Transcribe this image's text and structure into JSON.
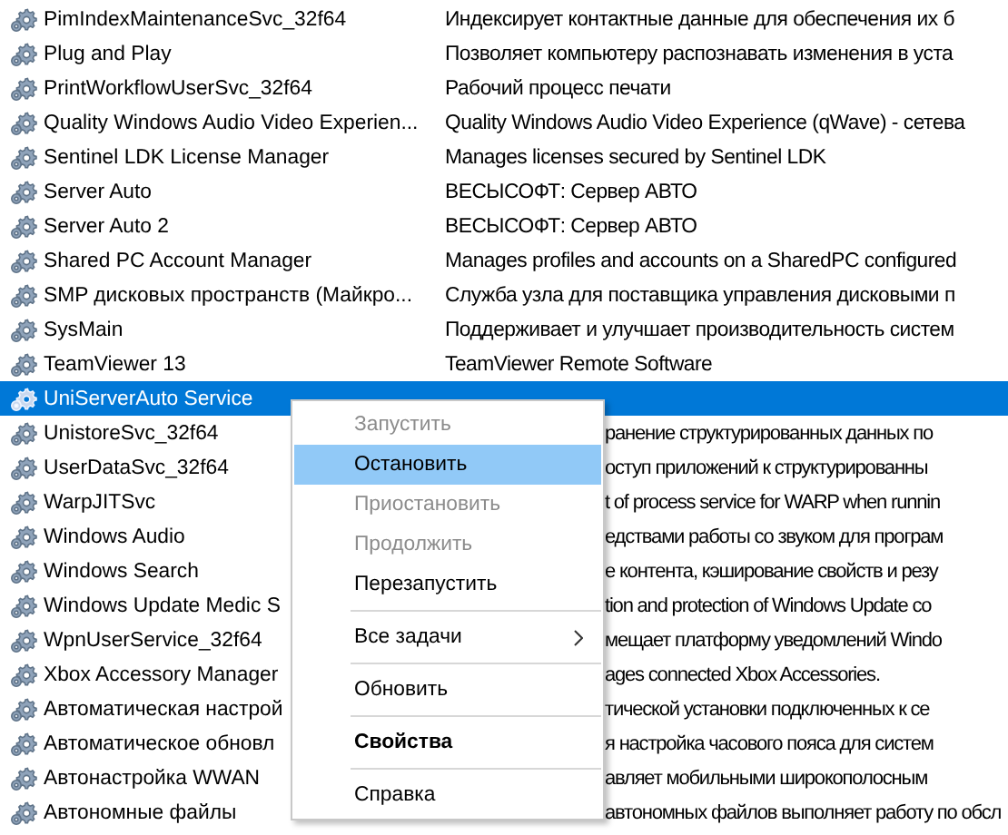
{
  "services": [
    {
      "name": "PimIndexMaintenanceSvc_32f64",
      "description": "Индексирует контактные данные для обеспечения их б",
      "selected": false,
      "covered": false
    },
    {
      "name": "Plug and Play",
      "description": "Позволяет компьютеру распознавать изменения в уста",
      "selected": false,
      "covered": false
    },
    {
      "name": "PrintWorkflowUserSvc_32f64",
      "description": "Рабочий процесс печати",
      "selected": false,
      "covered": false
    },
    {
      "name": "Quality Windows Audio Video Experien...",
      "description": "Quality Windows Audio Video Experience (qWave) - сетева",
      "selected": false,
      "covered": false
    },
    {
      "name": "Sentinel LDK License Manager",
      "description": "Manages licenses secured by Sentinel LDK",
      "selected": false,
      "covered": false
    },
    {
      "name": "Server Auto",
      "description": "ВЕСЫСОФТ: Сервер АВТО",
      "selected": false,
      "covered": false
    },
    {
      "name": "Server Auto 2",
      "description": "ВЕСЫСОФТ: Сервер АВТО",
      "selected": false,
      "covered": false
    },
    {
      "name": "Shared PC Account Manager",
      "description": "Manages profiles and accounts on a SharedPC configured",
      "selected": false,
      "covered": false
    },
    {
      "name": "SMP дисковых пространств (Майкро...",
      "description": "Служба узла для поставщика управления дисковыми п",
      "selected": false,
      "covered": false
    },
    {
      "name": "SysMain",
      "description": "Поддерживает и улучшает производительность систем",
      "selected": false,
      "covered": false
    },
    {
      "name": "TeamViewer 13",
      "description": "TeamViewer Remote Software",
      "selected": false,
      "covered": false
    },
    {
      "name": "UniServerAuto Service",
      "selected": true,
      "covered": false
    },
    {
      "name": "UnistoreSvc_32f64",
      "description": "ранение структурированных данных по",
      "selected": false,
      "covered": true
    },
    {
      "name": "UserDataSvc_32f64",
      "description": "оступ приложений к структурированны",
      "selected": false,
      "covered": true
    },
    {
      "name": "WarpJITSvc",
      "description": "t of process service for WARP when runnin",
      "selected": false,
      "covered": true
    },
    {
      "name": "Windows Audio",
      "description": "едствами работы со звуком для програм",
      "selected": false,
      "covered": true
    },
    {
      "name": "Windows Search",
      "description": "е контента, кэширование свойств и резу",
      "selected": false,
      "covered": true
    },
    {
      "name": "Windows Update Medic S",
      "description": "tion and protection of Windows Update co",
      "selected": false,
      "covered": true
    },
    {
      "name": "WpnUserService_32f64",
      "description": "мещает платформу уведомлений Windo",
      "selected": false,
      "covered": true
    },
    {
      "name": "Xbox Accessory Manager",
      "description": "ages connected Xbox Accessories.",
      "selected": false,
      "covered": true
    },
    {
      "name": "Автоматическая настрой",
      "description": "тической установки подключенных к се",
      "selected": false,
      "covered": true
    },
    {
      "name": "Автоматическое обновл",
      "description": "я настройка часового пояса для систем",
      "selected": false,
      "covered": true
    },
    {
      "name": "Автонастройка WWAN",
      "description": "авляет мобильными широкополосным",
      "selected": false,
      "covered": true
    },
    {
      "name": "Автономные файлы",
      "description": "автономных файлов выполняет работу по обсл",
      "selected": false,
      "covered": true
    }
  ],
  "context_menu": [
    {
      "kind": "item",
      "label": "Запустить",
      "disabled": true,
      "selected": false
    },
    {
      "kind": "item",
      "label": "Остановить",
      "disabled": false,
      "selected": true
    },
    {
      "kind": "item",
      "label": "Приостановить",
      "disabled": true,
      "selected": false
    },
    {
      "kind": "item",
      "label": "Продолжить",
      "disabled": true,
      "selected": false
    },
    {
      "kind": "item",
      "label": "Перезапустить",
      "disabled": false,
      "selected": false
    },
    {
      "kind": "separator"
    },
    {
      "kind": "item",
      "label": "Все задачи",
      "disabled": false,
      "selected": false,
      "submenu": true
    },
    {
      "kind": "separator"
    },
    {
      "kind": "item",
      "label": "Обновить",
      "disabled": false,
      "selected": false
    },
    {
      "kind": "separator"
    },
    {
      "kind": "item",
      "label": "Свойства",
      "disabled": false,
      "selected": false,
      "default": true
    },
    {
      "kind": "separator"
    },
    {
      "kind": "item",
      "label": "Справка",
      "disabled": false,
      "selected": false
    }
  ]
}
